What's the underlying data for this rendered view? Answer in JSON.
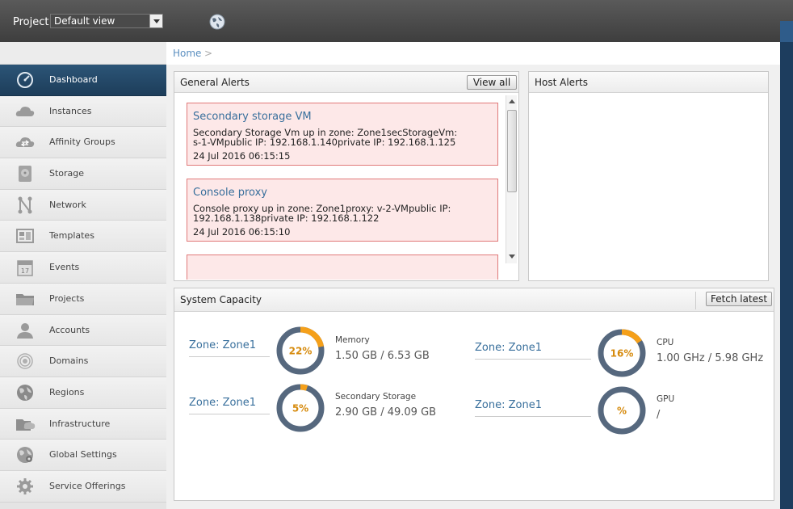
{
  "header": {
    "project_label": "Project:",
    "project_selected": "Default view"
  },
  "breadcrumb": {
    "home": "Home",
    "separator": ">"
  },
  "sidebar": {
    "items": [
      {
        "label": "Dashboard",
        "icon": "dashboard-icon",
        "active": true
      },
      {
        "label": "Instances",
        "icon": "cloud-icon"
      },
      {
        "label": "Affinity Groups",
        "icon": "affinity-cloud-icon"
      },
      {
        "label": "Storage",
        "icon": "storage-disk-icon"
      },
      {
        "label": "Network",
        "icon": "network-icon"
      },
      {
        "label": "Templates",
        "icon": "templates-icon"
      },
      {
        "label": "Events",
        "icon": "calendar-icon"
      },
      {
        "label": "Projects",
        "icon": "folder-icon"
      },
      {
        "label": "Accounts",
        "icon": "user-icon"
      },
      {
        "label": "Domains",
        "icon": "domains-icon"
      },
      {
        "label": "Regions",
        "icon": "globe-icon"
      },
      {
        "label": "Infrastructure",
        "icon": "infrastructure-icon"
      },
      {
        "label": "Global Settings",
        "icon": "global-settings-icon"
      },
      {
        "label": "Service Offerings",
        "icon": "gear-icon"
      }
    ]
  },
  "general_alerts": {
    "title": "General Alerts",
    "view_all": "View all",
    "alerts": [
      {
        "title": "Secondary storage VM",
        "line1": "Secondary Storage Vm up in zone: Zone1secStorageVm:",
        "line2": "s-1-VMpublic IP: 192.168.1.140private IP: 192.168.1.125",
        "time": "24 Jul 2016 06:15:15"
      },
      {
        "title": "Console proxy",
        "line1": "Console proxy up in zone: Zone1proxy: v-2-VMpublic IP:",
        "line2": "192.168.1.138private IP: 192.168.1.122",
        "time": "24 Jul 2016 06:15:10"
      }
    ]
  },
  "host_alerts": {
    "title": "Host Alerts"
  },
  "system_capacity": {
    "title": "System Capacity",
    "fetch_latest": "Fetch latest",
    "items": [
      {
        "zone": "Zone: Zone1",
        "metric": "Memory",
        "value": "1.50 GB / 6.53 GB",
        "percent_label": "22%",
        "fraction": 0.22
      },
      {
        "zone": "Zone: Zone1",
        "metric": "CPU",
        "value": "1.00 GHz / 5.98 GHz",
        "percent_label": "16%",
        "fraction": 0.16
      },
      {
        "zone": "Zone: Zone1",
        "metric": "Secondary Storage",
        "value": "2.90 GB / 49.09 GB",
        "percent_label": "5%",
        "fraction": 0.05
      },
      {
        "zone": "Zone: Zone1",
        "metric": "GPU",
        "value": "/",
        "percent_label": "%",
        "fraction": 0
      }
    ]
  },
  "colors": {
    "accent": "#f5a01a",
    "track": "#56687e",
    "link": "#386f9c",
    "alert_bg": "#fde8e8",
    "alert_border": "#e07a7a",
    "active_nav": "#1d3d5a"
  }
}
